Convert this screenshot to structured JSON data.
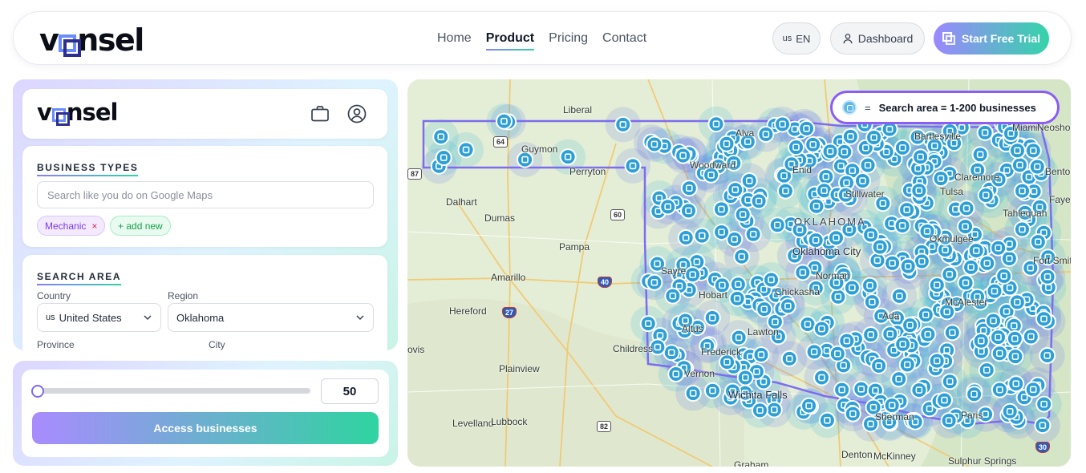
{
  "nav": {
    "brand": "vonsel",
    "links": [
      {
        "label": "Home"
      },
      {
        "label": "Product"
      },
      {
        "label": "Pricing"
      },
      {
        "label": "Contact"
      }
    ],
    "lang_flag": "us",
    "lang_code": "EN",
    "dashboard_label": "Dashboard",
    "trial_label": "Start Free Trial"
  },
  "panel": {
    "brand": "vonsel",
    "business_types": {
      "title": "BUSINESS TYPES",
      "search_placeholder": "Search like you do on Google Maps",
      "chips": [
        {
          "label": "Mechanic",
          "remove": "×"
        },
        {
          "label": "+ add new"
        }
      ]
    },
    "search_area": {
      "title": "SEARCH AREA",
      "country_label": "Country",
      "country_flag": "us",
      "country_value": "United States",
      "region_label": "Region",
      "region_value": "Oklahoma",
      "province_label": "Province",
      "city_label": "City"
    },
    "slider": {
      "value": "50",
      "fraction": 0.0
    },
    "access_label": "Access businesses"
  },
  "map": {
    "legend": {
      "eq": "=",
      "text": "Search area = 1-200 businesses"
    },
    "state_label": "OKLAHOMA",
    "cities": [
      "Liberal",
      "Guymon",
      "Perryton",
      "Dalhart",
      "Dumas",
      "Pampa",
      "Amarillo",
      "Hereford",
      "Childress",
      "Plainview",
      "Levelland",
      "Lubbock",
      "Woodward",
      "Enid",
      "Stillwater",
      "Bartlesville",
      "Tulsa",
      "Claremore",
      "Tahlequah",
      "Okmulgee",
      "Oklahoma City",
      "Norman",
      "Chickasha",
      "Lawton",
      "Altus",
      "Hobart",
      "Sayre",
      "Frederick",
      "Vernon",
      "Wichita Falls",
      "Ada",
      "McAlester",
      "Fort Smith",
      "Sherman",
      "Paris",
      "Denton",
      "McKinney",
      "Sulphur Springs",
      "Graham",
      "Alva",
      "Miami",
      "Neosho",
      "Bento",
      "Faye",
      "ovis"
    ],
    "routes": [
      "64",
      "60",
      "40",
      "27",
      "82",
      "87",
      "30"
    ]
  },
  "colors": {
    "accent_purple": "#8b5cf6",
    "accent_green": "#2fd4a0",
    "pin_blue": "#3da4dc",
    "state_border": "#7c6cf0"
  }
}
